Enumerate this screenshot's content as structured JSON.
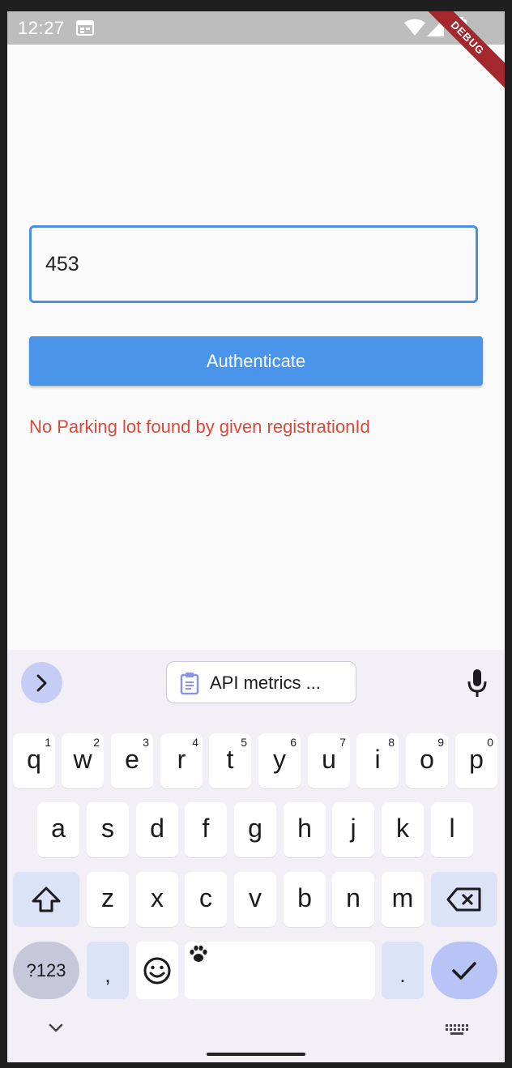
{
  "status_bar": {
    "time": "12:27",
    "debug_label": "DEBUG"
  },
  "form": {
    "registration_value": "453",
    "authenticate_label": "Authenticate",
    "error_message": "No Parking lot found by given registrationId"
  },
  "keyboard": {
    "clipboard_suggestion": "API metrics ...",
    "row1": [
      {
        "letter": "q",
        "num": "1"
      },
      {
        "letter": "w",
        "num": "2"
      },
      {
        "letter": "e",
        "num": "3"
      },
      {
        "letter": "r",
        "num": "4"
      },
      {
        "letter": "t",
        "num": "5"
      },
      {
        "letter": "y",
        "num": "6"
      },
      {
        "letter": "u",
        "num": "7"
      },
      {
        "letter": "i",
        "num": "8"
      },
      {
        "letter": "o",
        "num": "9"
      },
      {
        "letter": "p",
        "num": "0"
      }
    ],
    "row2": [
      "a",
      "s",
      "d",
      "f",
      "g",
      "h",
      "j",
      "k",
      "l"
    ],
    "row3": [
      "z",
      "x",
      "c",
      "v",
      "b",
      "n",
      "m"
    ],
    "symbols_label": "?123",
    "comma": ",",
    "period": "."
  },
  "colors": {
    "accent": "#4a94ea",
    "error": "#d84a3c",
    "debug_banner": "#a3292f"
  },
  "icons": [
    "calendar-icon",
    "wifi-icon",
    "signal-icon",
    "battery-icon",
    "chevron-right-icon",
    "clipboard-icon",
    "mic-icon",
    "shift-icon",
    "backspace-icon",
    "emoji-icon",
    "paw-icon",
    "check-icon",
    "chevron-down-icon",
    "keyboard-icon"
  ]
}
